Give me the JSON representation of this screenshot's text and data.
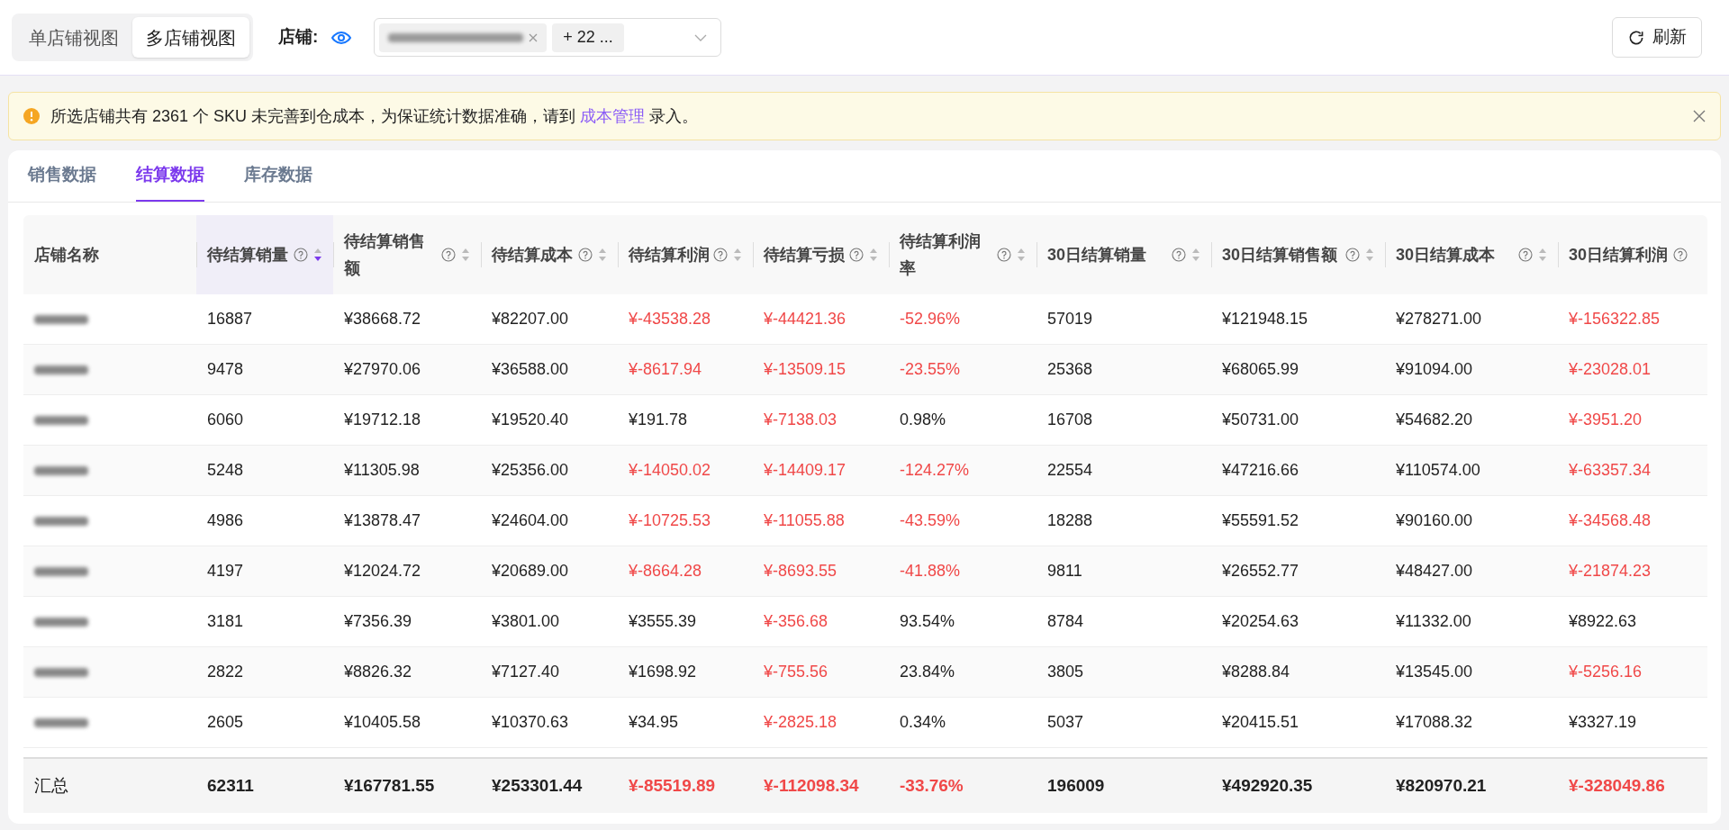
{
  "view_switch": [
    {
      "label": "单店铺视图",
      "selected": false
    },
    {
      "label": "多店铺视图",
      "selected": true
    }
  ],
  "store_filter": {
    "label": "店铺:",
    "chips": [
      {
        "kind": "blurred",
        "removable": true
      },
      {
        "kind": "count",
        "text": "+ 22 ..."
      }
    ]
  },
  "refresh_button": {
    "label": "刷新"
  },
  "alert": {
    "before": "所选店铺共有 2361 个 SKU 未完善到仓成本，为保证统计数据准确，请到",
    "link": "成本管理",
    "after": "录入。"
  },
  "tabs": [
    {
      "label": "销售数据",
      "selected": false
    },
    {
      "label": "结算数据",
      "selected": true
    },
    {
      "label": "库存数据",
      "selected": false
    }
  ],
  "table": {
    "columns": [
      {
        "label": "店铺名称",
        "help": false,
        "sortable": false,
        "sorted_desc": false
      },
      {
        "label": "待结算销量",
        "help": true,
        "sortable": true,
        "sorted_desc": true
      },
      {
        "label": "待结算销售额",
        "help": true,
        "sortable": true,
        "sorted_desc": false
      },
      {
        "label": "待结算成本",
        "help": true,
        "sortable": true,
        "sorted_desc": false
      },
      {
        "label": "待结算利润",
        "help": true,
        "sortable": true,
        "sorted_desc": false
      },
      {
        "label": "待结算亏损",
        "help": true,
        "sortable": true,
        "sorted_desc": false
      },
      {
        "label": "待结算利润率",
        "help": true,
        "sortable": true,
        "sorted_desc": false
      },
      {
        "label": "30日结算销量",
        "help": true,
        "sortable": true,
        "sorted_desc": false
      },
      {
        "label": "30日结算销售额",
        "help": true,
        "sortable": true,
        "sorted_desc": false
      },
      {
        "label": "30日结算成本",
        "help": true,
        "sortable": true,
        "sorted_desc": false
      },
      {
        "label": "30日结算利润",
        "help": true,
        "sortable": false,
        "sorted_desc": false
      }
    ],
    "rows": [
      {
        "values": [
          "16887",
          "¥38668.72",
          "¥82207.00",
          "¥-43538.28",
          "¥-44421.36",
          "-52.96%",
          "57019",
          "¥121948.15",
          "¥278271.00",
          "¥-156322.85"
        ],
        "negative": [
          false,
          false,
          false,
          true,
          true,
          true,
          false,
          false,
          false,
          true
        ]
      },
      {
        "values": [
          "9478",
          "¥27970.06",
          "¥36588.00",
          "¥-8617.94",
          "¥-13509.15",
          "-23.55%",
          "25368",
          "¥68065.99",
          "¥91094.00",
          "¥-23028.01"
        ],
        "negative": [
          false,
          false,
          false,
          true,
          true,
          true,
          false,
          false,
          false,
          true
        ]
      },
      {
        "values": [
          "6060",
          "¥19712.18",
          "¥19520.40",
          "¥191.78",
          "¥-7138.03",
          "0.98%",
          "16708",
          "¥50731.00",
          "¥54682.20",
          "¥-3951.20"
        ],
        "negative": [
          false,
          false,
          false,
          false,
          true,
          false,
          false,
          false,
          false,
          true
        ]
      },
      {
        "values": [
          "5248",
          "¥11305.98",
          "¥25356.00",
          "¥-14050.02",
          "¥-14409.17",
          "-124.27%",
          "22554",
          "¥47216.66",
          "¥110574.00",
          "¥-63357.34"
        ],
        "negative": [
          false,
          false,
          false,
          true,
          true,
          true,
          false,
          false,
          false,
          true
        ]
      },
      {
        "values": [
          "4986",
          "¥13878.47",
          "¥24604.00",
          "¥-10725.53",
          "¥-11055.88",
          "-43.59%",
          "18288",
          "¥55591.52",
          "¥90160.00",
          "¥-34568.48"
        ],
        "negative": [
          false,
          false,
          false,
          true,
          true,
          true,
          false,
          false,
          false,
          true
        ]
      },
      {
        "values": [
          "4197",
          "¥12024.72",
          "¥20689.00",
          "¥-8664.28",
          "¥-8693.55",
          "-41.88%",
          "9811",
          "¥26552.77",
          "¥48427.00",
          "¥-21874.23"
        ],
        "negative": [
          false,
          false,
          false,
          true,
          true,
          true,
          false,
          false,
          false,
          true
        ]
      },
      {
        "values": [
          "3181",
          "¥7356.39",
          "¥3801.00",
          "¥3555.39",
          "¥-356.68",
          "93.54%",
          "8784",
          "¥20254.63",
          "¥11332.00",
          "¥8922.63"
        ],
        "negative": [
          false,
          false,
          false,
          false,
          true,
          false,
          false,
          false,
          false,
          false
        ]
      },
      {
        "values": [
          "2822",
          "¥8826.32",
          "¥7127.40",
          "¥1698.92",
          "¥-755.56",
          "23.84%",
          "3805",
          "¥8288.84",
          "¥13545.00",
          "¥-5256.16"
        ],
        "negative": [
          false,
          false,
          false,
          false,
          true,
          false,
          false,
          false,
          false,
          true
        ]
      },
      {
        "values": [
          "2605",
          "¥10405.58",
          "¥10370.63",
          "¥34.95",
          "¥-2825.18",
          "0.34%",
          "5037",
          "¥20415.51",
          "¥17088.32",
          "¥3327.19"
        ],
        "negative": [
          false,
          false,
          false,
          false,
          true,
          false,
          false,
          false,
          false,
          false
        ]
      }
    ],
    "summary": {
      "label": "汇总",
      "values": [
        "62311",
        "¥167781.55",
        "¥253301.44",
        "¥-85519.89",
        "¥-112098.34",
        "-33.76%",
        "196009",
        "¥492920.35",
        "¥820970.21",
        "¥-328049.86"
      ],
      "negative": [
        false,
        false,
        false,
        true,
        true,
        true,
        false,
        false,
        false,
        true
      ]
    }
  }
}
